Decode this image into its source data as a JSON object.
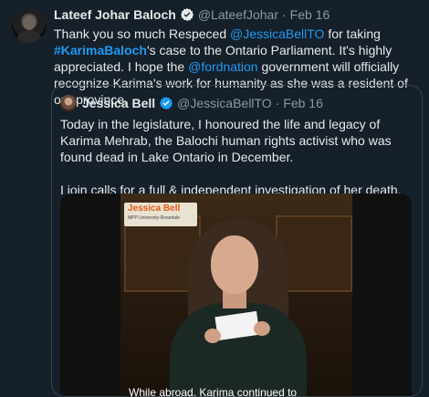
{
  "author": {
    "name": "Lateef Johar Baloch",
    "handle": "@LateefJohar",
    "date": "Feb 16"
  },
  "tweet_text": {
    "t1": "Thank you so much Respeced ",
    "mention1": "@JessicaBellTO",
    "t2": " for taking ",
    "hashtag": "#KarimaBaloch",
    "t3": "'s case to the Ontario Parliament. It's highly appreciated. I hope the ",
    "mention2": "@fordnation",
    "t4": " government will officially recognize Karima's work for humanity as she was a resident of our province."
  },
  "quote": {
    "name": "Jessica Bell",
    "handle": "@JessicaBellTO",
    "date": "Feb 16",
    "para1": "Today in the legislature, I honoured the life and legacy of Karima Mehrab, the Balochi human rights activist who was found dead in Lake Ontario in December.",
    "para2": "I join calls for a full & independent investigation of her death.",
    "video_overlay_title": "Jessica Bell",
    "video_overlay_sub": "MPP University-Rosedale",
    "video_caption": "While abroad, Karima continued to"
  },
  "colors": {
    "background": "#15202b",
    "link": "#1d9bf0",
    "muted": "#8b98a5",
    "verified": "#1d9bf0"
  }
}
